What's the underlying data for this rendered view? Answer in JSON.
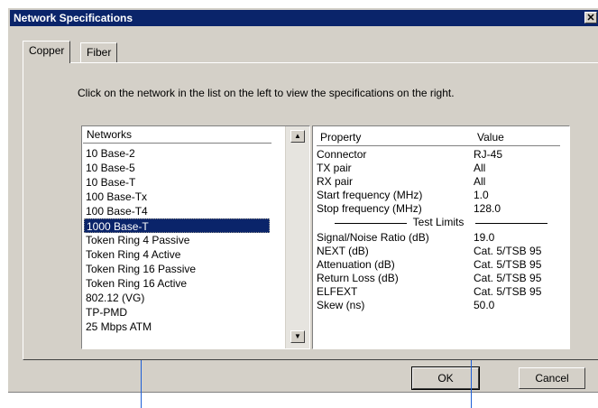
{
  "window": {
    "title": "Network Specifications",
    "close_glyph": "✕"
  },
  "tabs": [
    {
      "label": "Copper",
      "active": true
    },
    {
      "label": "Fiber",
      "active": false
    }
  ],
  "instructions": "Click on the network in the list on the left to view the specifications on the right.",
  "networks": {
    "header": "Networks",
    "selected": "1000 Base-T",
    "items": [
      "10 Base-2",
      "10 Base-5",
      "10 Base-T",
      "100 Base-Tx",
      "100 Base-T4",
      "1000 Base-T",
      "Token Ring 4 Passive",
      "Token Ring 4 Active",
      "Token Ring 16 Passive",
      "Token Ring 16 Active",
      "802.12 (VG)",
      "TP-PMD",
      "25 Mbps ATM"
    ]
  },
  "properties": {
    "header_property": "Property",
    "header_value": "Value",
    "rows": [
      {
        "property": "Connector",
        "value": "RJ-45"
      },
      {
        "property": "TX pair",
        "value": "All"
      },
      {
        "property": "RX pair",
        "value": "All"
      },
      {
        "property": "Start frequency (MHz)",
        "value": "1.0"
      },
      {
        "property": "Stop frequency (MHz)",
        "value": "128.0"
      }
    ],
    "section_label": "Test Limits",
    "test_rows": [
      {
        "property": "Signal/Noise Ratio (dB)",
        "value": "19.0"
      },
      {
        "property": "NEXT (dB)",
        "value": "Cat. 5/TSB 95"
      },
      {
        "property": "Attenuation (dB)",
        "value": "Cat. 5/TSB 95"
      },
      {
        "property": "Return Loss (dB)",
        "value": "Cat. 5/TSB 95"
      },
      {
        "property": "ELFEXT",
        "value": "Cat. 5/TSB 95"
      },
      {
        "property": "Skew (ns)",
        "value": "50.0"
      }
    ]
  },
  "buttons": {
    "ok": "OK",
    "cancel": "Cancel"
  },
  "colors": {
    "selection": "#0a246a",
    "titlebar": "#0a246a",
    "callout": "#1f5fd6"
  },
  "icons": {
    "scroll_up": "▲",
    "scroll_down": "▼"
  }
}
